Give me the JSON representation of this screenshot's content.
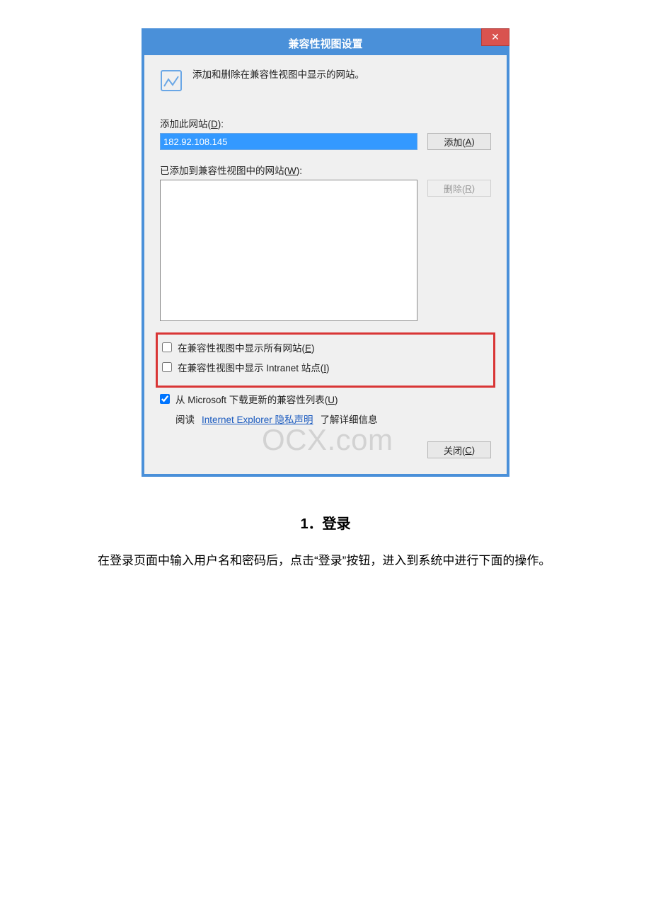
{
  "dialog": {
    "title": "兼容性视图设置",
    "close_icon_label": "✕",
    "intro": "添加和删除在兼容性视图中显示的网站。",
    "add_label_prefix": "添加此网站(",
    "add_label_key": "D",
    "add_label_suffix": "):",
    "input_value": "182.92.108.145",
    "add_button_prefix": "添加(",
    "add_button_key": "A",
    "add_button_suffix": ")",
    "list_label_prefix": "已添加到兼容性视图中的网站(",
    "list_label_key": "W",
    "list_label_suffix": "):",
    "remove_button_prefix": "删除(",
    "remove_button_key": "R",
    "remove_button_suffix": ")",
    "chk_all_sites_prefix": "在兼容性视图中显示所有网站(",
    "chk_all_sites_key": "E",
    "chk_all_sites_suffix": ")",
    "chk_intranet_prefix": "在兼容性视图中显示 Intranet 站点(",
    "chk_intranet_key": "I",
    "chk_intranet_suffix": ")",
    "chk_ms_list_prefix": "从 Microsoft 下载更新的兼容性列表(",
    "chk_ms_list_key": "U",
    "chk_ms_list_suffix": ")",
    "info_prefix": "阅读 ",
    "info_link": "Internet Explorer 隐私声明",
    "info_suffix": " 了解详细信息",
    "close_button_prefix": "关闭(",
    "close_button_key": "C",
    "close_button_suffix": ")"
  },
  "watermark": "OCX.com",
  "doc": {
    "heading": "1．登录",
    "paragraph": "在登录页面中输入用户名和密码后，点击“登录”按钮，进入到系统中进行下面的操作。"
  }
}
